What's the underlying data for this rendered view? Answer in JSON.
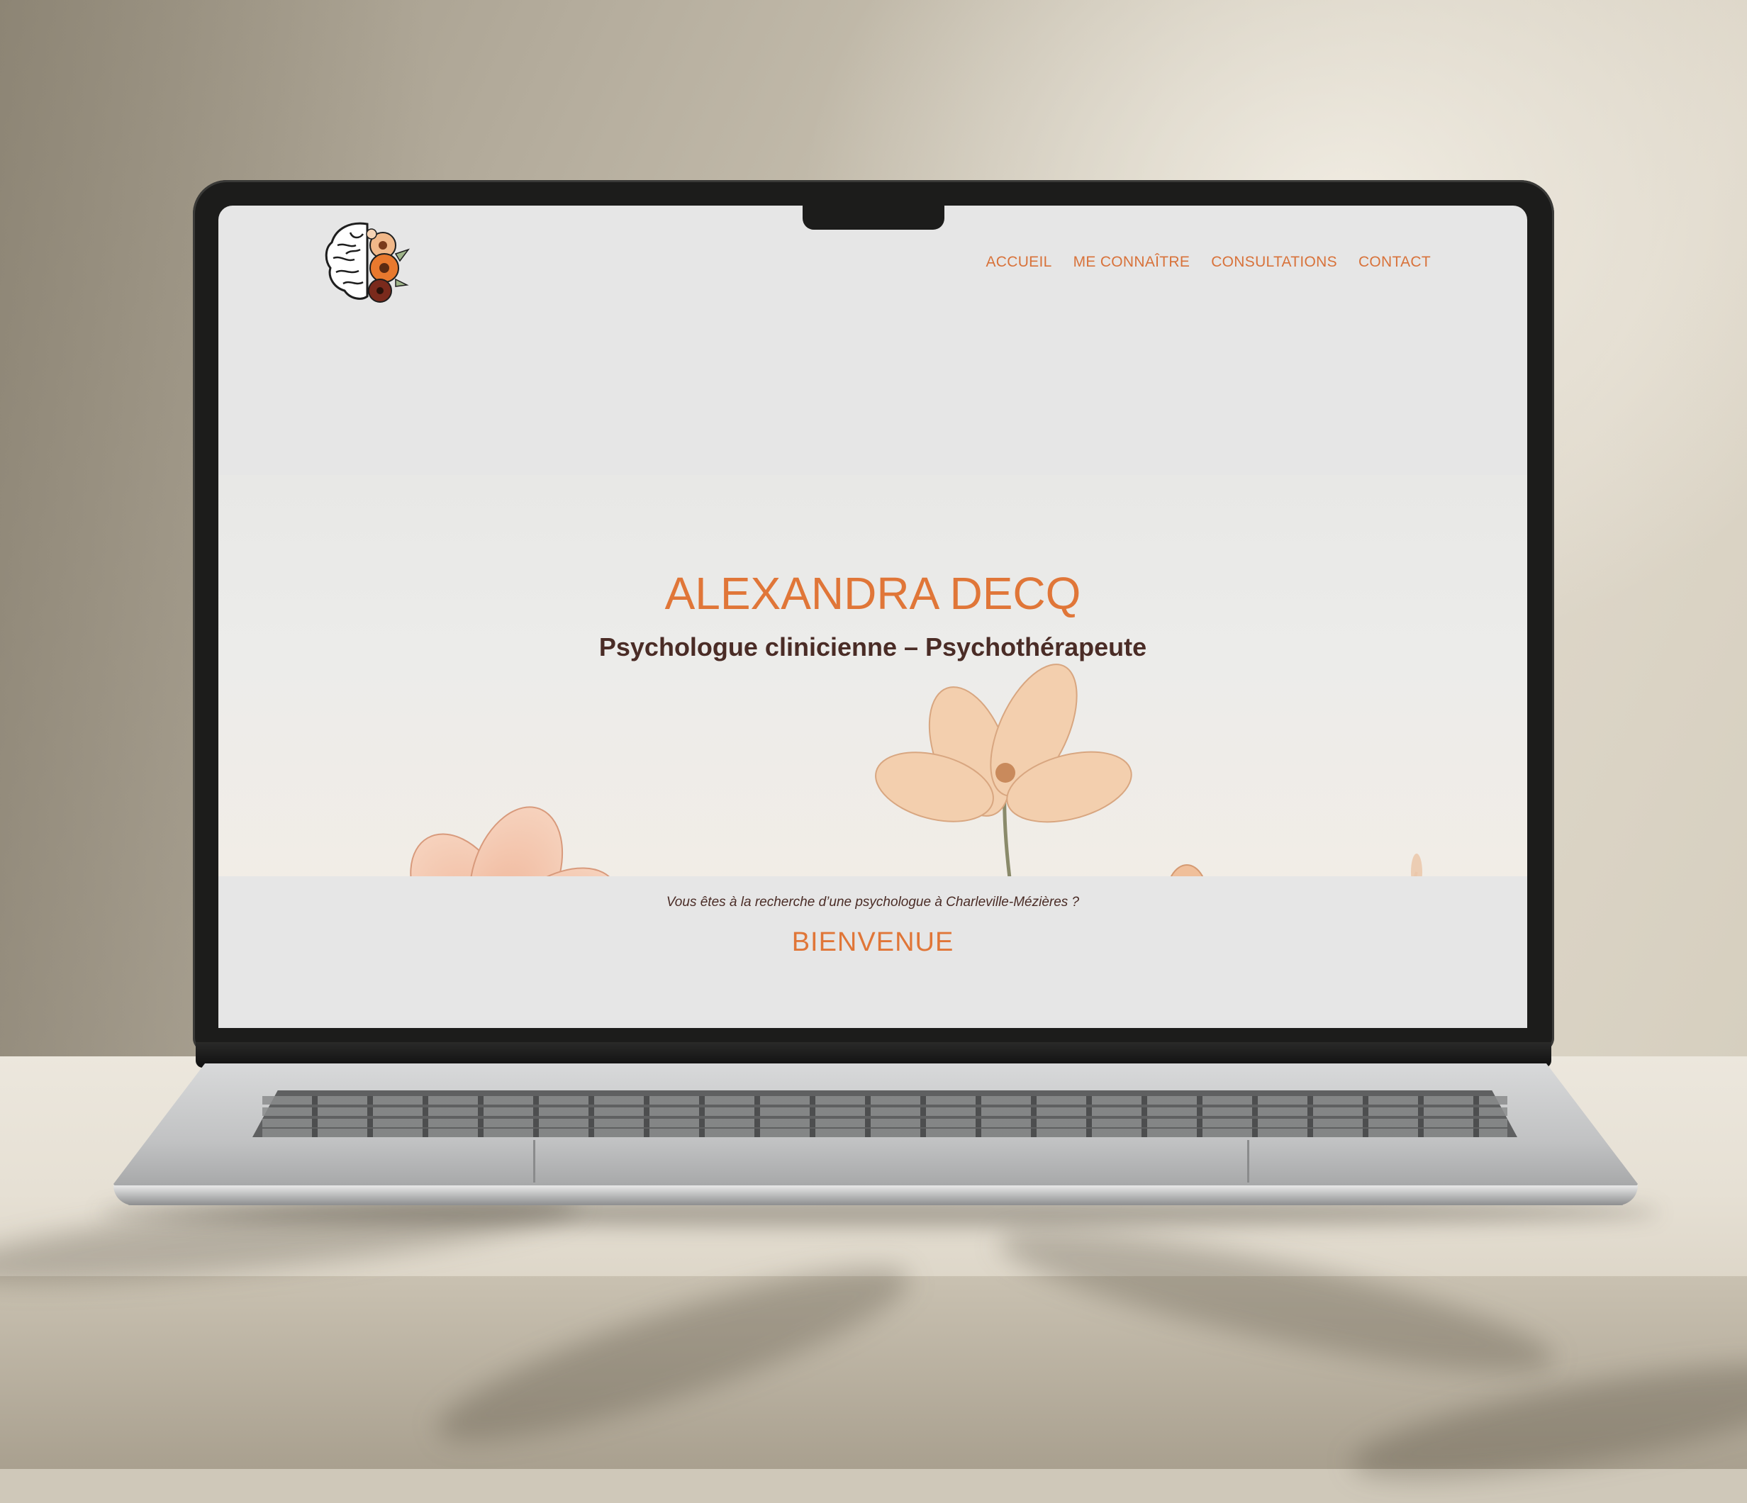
{
  "site": {
    "nav": {
      "items": [
        {
          "label": "ACCUEIL"
        },
        {
          "label": "ME CONNAÎTRE"
        },
        {
          "label": "CONSULTATIONS"
        },
        {
          "label": "CONTACT"
        }
      ]
    },
    "hero": {
      "title": "ALEXANDRA DECQ",
      "subtitle": "Psychologue clinicienne – Psychothérapeute"
    },
    "welcome": {
      "tagline": "Vous êtes à la recherche d’une psychologue à Charleville-Mézières ?",
      "heading": "BIENVENUE"
    },
    "logo_icon": "brain-flowers-icon"
  },
  "colors": {
    "accent": "#e07638",
    "text_dark": "#4a2c26",
    "page_bg": "#e6e6e6",
    "flower": "#eab394"
  }
}
